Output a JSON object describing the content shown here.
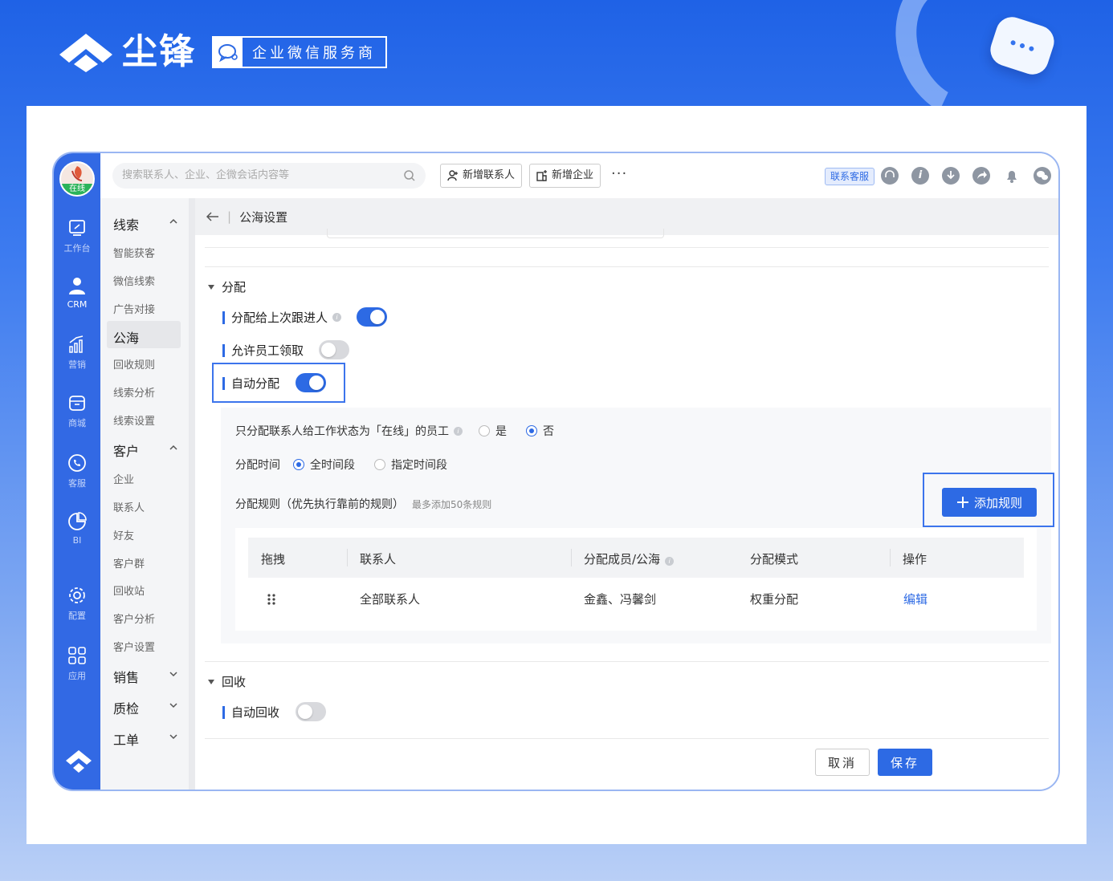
{
  "banner": {
    "brand_name": "尘锋",
    "badge_text": "企业微信服务商"
  },
  "topbar": {
    "search_placeholder": "搜索联系人、企业、企微会话内容等",
    "add_contact": "新增联系人",
    "add_company": "新增企业",
    "more": "···",
    "contact_support": "联系客服",
    "info_icon_text": "i"
  },
  "rail": {
    "status": "在线",
    "items": [
      {
        "label": "工作台",
        "icon": "workbench-icon"
      },
      {
        "label": "CRM",
        "icon": "person-icon"
      },
      {
        "label": "营销",
        "icon": "chart-icon"
      },
      {
        "label": "商城",
        "icon": "shop-icon"
      },
      {
        "label": "客服",
        "icon": "phone-icon"
      },
      {
        "label": "BI",
        "icon": "pie-icon"
      },
      {
        "label": "配置",
        "icon": "gear-icon"
      },
      {
        "label": "应用",
        "icon": "apps-icon"
      }
    ]
  },
  "sidebar": {
    "leads": "线索",
    "lead_items": [
      "智能获客",
      "微信线索",
      "广告对接",
      "公海",
      "回收规则",
      "线索分析",
      "线索设置"
    ],
    "customers": "客户",
    "customer_items": [
      "企业",
      "联系人",
      "好友",
      "客户群",
      "回收站",
      "客户分析",
      "客户设置"
    ],
    "sales": "销售",
    "qc": "质检",
    "ticket": "工单"
  },
  "page": {
    "title": "公海设置",
    "assign_section": "分配",
    "assign_last": "分配给上次跟进人",
    "allow_claim": "允许员工领取",
    "auto_assign": "自动分配",
    "online_only": "只分配联系人给工作状态为「在线」的员工",
    "yes": "是",
    "no": "否",
    "assign_time": "分配时间",
    "all_time": "全时间段",
    "specific_time": "指定时间段",
    "rules_label": "分配规则（优先执行靠前的规则）",
    "rules_hint": "最多添加50条规则",
    "add_rule": "添加规则",
    "recycle_section": "回收",
    "auto_recycle": "自动回收",
    "cancel": "取消",
    "save": "保存"
  },
  "toggles": {
    "assign_last": true,
    "allow_claim": false,
    "auto_assign": true,
    "auto_recycle": false
  },
  "table": {
    "headers": [
      "拖拽",
      "联系人",
      "分配成员/公海",
      "分配模式",
      "操作"
    ],
    "rows": [
      {
        "contact": "全部联系人",
        "members": "金鑫、冯馨剑",
        "mode": "权重分配",
        "action": "编辑"
      }
    ]
  },
  "colors": {
    "primary": "#2d6ae4",
    "rail": "#3269e4",
    "online": "#2bb35a"
  }
}
